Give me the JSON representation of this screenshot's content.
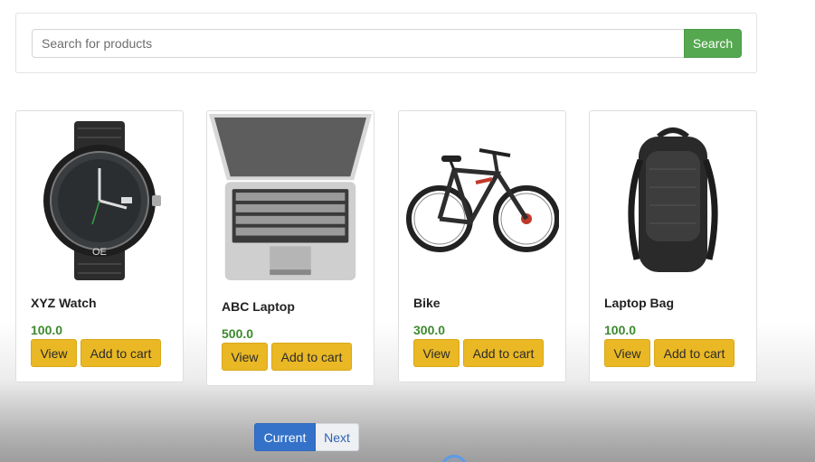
{
  "search": {
    "placeholder": "Search for products",
    "button_label": "Search"
  },
  "products": [
    {
      "name": "XYZ Watch",
      "price": "100.0",
      "view_label": "View",
      "cart_label": "Add to cart",
      "icon": "watch-icon"
    },
    {
      "name": "ABC Laptop",
      "price": "500.0",
      "view_label": "View",
      "cart_label": "Add to cart",
      "icon": "laptop-icon"
    },
    {
      "name": "Bike",
      "price": "300.0",
      "view_label": "View",
      "cart_label": "Add to cart",
      "icon": "bike-icon"
    },
    {
      "name": "Laptop Bag",
      "price": "100.0",
      "view_label": "View",
      "cart_label": "Add to cart",
      "icon": "backpack-icon"
    }
  ],
  "pagination": {
    "current_label": "Current",
    "next_label": "Next"
  },
  "colors": {
    "search_button": "#55a84f",
    "price": "#3c8a2e",
    "action_button": "#e9b824",
    "current_page": "#3472c9"
  }
}
